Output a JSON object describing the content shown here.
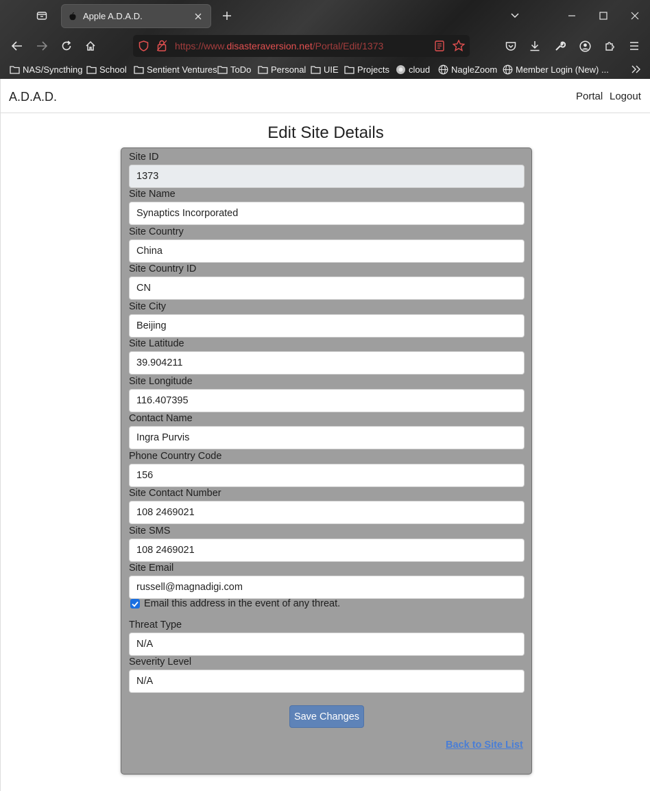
{
  "browser": {
    "tab_title": "Apple A.D.A.D.",
    "url_scheme": "https://www.",
    "url_host": "disasteraversion.net",
    "url_path": "/Portal/Edit/1373",
    "bookmarks": [
      {
        "label": "NAS/Syncthing",
        "icon": "folder-icon"
      },
      {
        "label": "School",
        "icon": "folder-icon"
      },
      {
        "label": "Sentient Ventures",
        "icon": "folder-icon"
      },
      {
        "label": "ToDo",
        "icon": "folder-icon"
      },
      {
        "label": "Personal",
        "icon": "folder-icon"
      },
      {
        "label": "UIE",
        "icon": "folder-icon"
      },
      {
        "label": "Projects",
        "icon": "folder-icon"
      },
      {
        "label": "cloud",
        "icon": "cloud-favicon"
      },
      {
        "label": "NagleZoom",
        "icon": "globe-icon"
      },
      {
        "label": "Member Login (New) ...",
        "icon": "globe-icon"
      }
    ]
  },
  "site_nav": {
    "brand": "A.D.A.D.",
    "links": [
      "Portal",
      "Logout"
    ]
  },
  "page": {
    "heading": "Edit Site Details"
  },
  "form": {
    "fields": [
      {
        "label": "Site ID",
        "value": "1373",
        "readonly": true
      },
      {
        "label": "Site Name",
        "value": "Synaptics Incorporated"
      },
      {
        "label": "Site Country",
        "value": "China"
      },
      {
        "label": "Site Country ID",
        "value": "CN"
      },
      {
        "label": "Site City",
        "value": "Beijing"
      },
      {
        "label": "Site Latitude",
        "value": "39.904211"
      },
      {
        "label": "Site Longitude",
        "value": "116.407395"
      },
      {
        "label": "Contact Name",
        "value": "Ingra Purvis"
      },
      {
        "label": "Phone Country Code",
        "value": "156"
      },
      {
        "label": "Site Contact Number",
        "value": "108 2469021"
      },
      {
        "label": "Site SMS",
        "value": "108 2469021"
      },
      {
        "label": "Site Email",
        "value": "russell@magnadigi.com"
      }
    ],
    "email_alert_label": "Email this address in the event of any threat.",
    "email_alert_checked": true,
    "threat_fields": [
      {
        "label": "Threat Type",
        "value": "N/A"
      },
      {
        "label": "Severity Level",
        "value": "N/A"
      }
    ],
    "save_label": "Save Changes",
    "back_label": "Back to Site List"
  },
  "colors": {
    "card_bg": "#9e9e9e",
    "save_button": "#5e83b8",
    "link": "#4a7ed6",
    "checkbox": "#1a6fe0"
  }
}
